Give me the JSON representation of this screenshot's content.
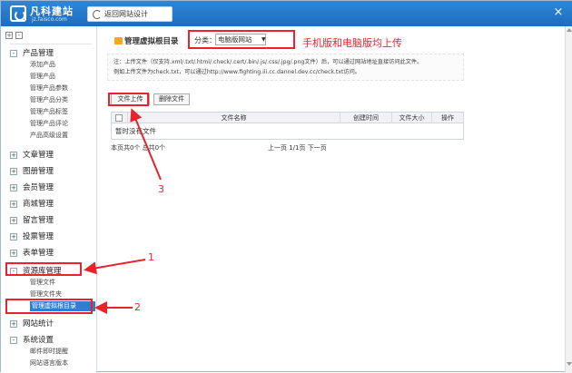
{
  "app": {
    "logo_name": "凡科建站",
    "logo_domain": "jz.faisco.com",
    "return_button": "返回网站设计",
    "close_label": "×"
  },
  "sidebar": {
    "toggles": [
      "+",
      "-"
    ],
    "groups": [
      {
        "label": "产品管理",
        "box": "-",
        "items": [
          "添加产品",
          "管理产品",
          "管理产品参数",
          "管理产品分类",
          "管理产品标签",
          "管理产品评论",
          "产品高级设置"
        ]
      },
      {
        "label": "文章管理",
        "box": "+"
      },
      {
        "label": "图册管理",
        "box": "+"
      },
      {
        "label": "会员管理",
        "box": "+"
      },
      {
        "label": "商城管理",
        "box": "+"
      },
      {
        "label": "留言管理",
        "box": "+"
      },
      {
        "label": "投票管理",
        "box": "+"
      },
      {
        "label": "表单管理",
        "box": "+"
      },
      {
        "label": "资源库管理",
        "box": "-",
        "items": [
          "管理文件",
          "管理文件夹",
          "管理虚拟根目录"
        ]
      },
      {
        "label": "网站统计",
        "box": "+"
      },
      {
        "label": "系统设置",
        "box": "-",
        "items": [
          "邮件即时提醒",
          "网站语言版本"
        ]
      }
    ]
  },
  "main": {
    "page_title": "管理虚拟根目录",
    "category_label": "分类：",
    "category_value": "电脑版网站",
    "notice_line1": "注：上传文件（仅支持.xml/.txt/.html/.check/.cert/.bin/.js/.css/.jpg/.png文件）后，可以通过网站地址直接访问此文件。",
    "notice_line2": "例如上传文件为check.txt，可以通过http://www.fighting.iii.cc.dannel.dev.cc/check.txt访问。",
    "upload_button": "文件上传",
    "delete_button": "删除文件",
    "table": {
      "columns": [
        "文件名称",
        "创建时间",
        "文件大小",
        "操作"
      ],
      "empty_text": "暂时没有文件"
    },
    "pager_total": "本页共0个 总共0个",
    "pager_nav": "上一页  1/1页  下一页"
  },
  "annotations": {
    "note_top": "手机版和电脑版均上传",
    "label_1": "1",
    "label_2": "2",
    "label_3": "3",
    "color": "#e8232b"
  }
}
